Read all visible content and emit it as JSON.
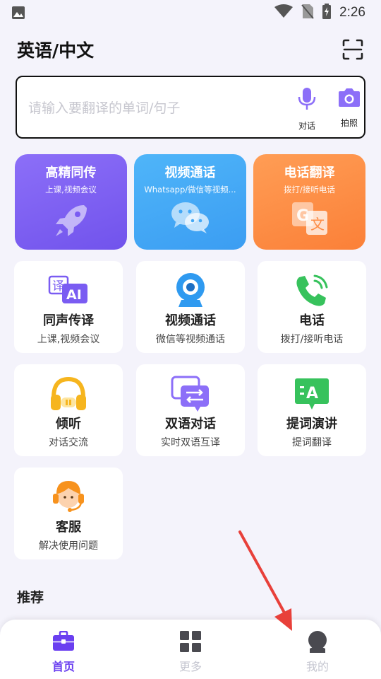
{
  "status_bar": {
    "time": "2:26"
  },
  "header": {
    "title": "英语/中文",
    "scan_icon": "scan-icon"
  },
  "search": {
    "placeholder": "请输入要翻译的单词/句子",
    "value": "",
    "mic_label": "对话",
    "photo_label": "拍照"
  },
  "features": [
    {
      "title": "高精同传",
      "subtitle": "上课,视频会议",
      "icon": "rocket-icon",
      "color": "#7a5cf2"
    },
    {
      "title": "视频通话",
      "subtitle": "Whatsapp/微信等视频...",
      "icon": "wechat-icon",
      "color": "#43a8f6"
    },
    {
      "title": "电话翻译",
      "subtitle": "拨打/接听电话",
      "icon": "translate-icon",
      "color": "#fd8c45"
    }
  ],
  "grid": [
    {
      "title": "同声传译",
      "subtitle": "上课,视频会议",
      "icon": "ai-translate-icon"
    },
    {
      "title": "视频通话",
      "subtitle": "微信等视频通话",
      "icon": "webcam-icon"
    },
    {
      "title": "电话",
      "subtitle": "拨打/接听电话",
      "icon": "phone-icon"
    },
    {
      "title": "倾听",
      "subtitle": "对话交流",
      "icon": "headphones-icon"
    },
    {
      "title": "双语对话",
      "subtitle": "实时双语互译",
      "icon": "chat-swap-icon"
    },
    {
      "title": "提词演讲",
      "subtitle": "提词翻译",
      "icon": "teleprompter-icon"
    },
    {
      "title": "客服",
      "subtitle": "解决使用问题",
      "icon": "customer-service-icon"
    }
  ],
  "recommend_title": "推荐",
  "nav": {
    "home": "首页",
    "more": "更多",
    "mine": "我的"
  },
  "colors": {
    "accent": "#6a3ff0",
    "arrow": "#e8403a"
  }
}
